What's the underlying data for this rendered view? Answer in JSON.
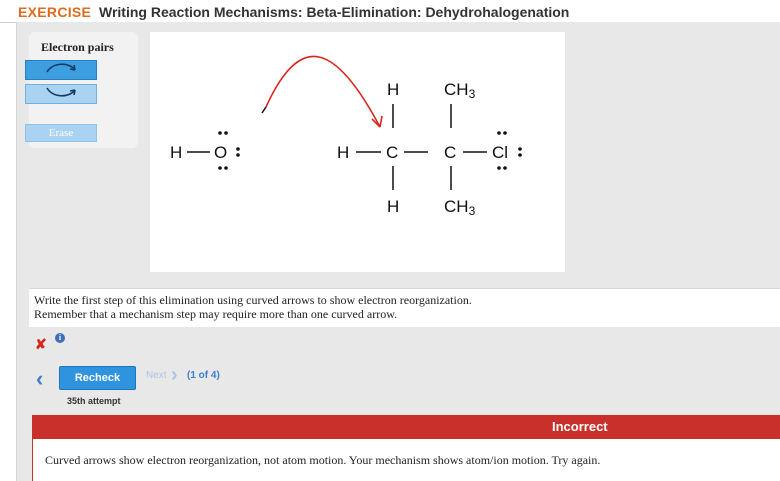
{
  "header": {
    "exercise_label": "EXERCISE",
    "title": "Writing Reaction Mechanisms: Beta-Elimination: Dehydrohalogenation"
  },
  "toolbox": {
    "title": "Electron pairs",
    "tools": [
      {
        "name": "arrow-clockwise-icon"
      },
      {
        "name": "arrow-counterclockwise-icon"
      }
    ],
    "erase_label": "Erase"
  },
  "molecule": {
    "labels": {
      "h_hydroxide": "H",
      "o_hydroxide": "O",
      "h_c1_top": "H",
      "h_c1_left": "H",
      "c1": "C",
      "h_c1_bottom": "H",
      "ch3_top": "CH",
      "ch3_top_sub": "3",
      "c2": "C",
      "cl": "Cl",
      "ch3_bottom": "CH",
      "ch3_bottom_sub": "3"
    },
    "colors": {
      "arrow": "#d9261c",
      "bond": "#111111"
    }
  },
  "instructions": {
    "line1": "Write the first step of this elimination using curved arrows to show electron reorganization.",
    "line2": "Remember that a mechanism step may require more than one curved arrow."
  },
  "status": {
    "result_icon": "x-mark-icon",
    "info_icon": "info-icon"
  },
  "navigation": {
    "recheck_label": "Recheck",
    "next_label": "Next",
    "counter": "(1 of 4)",
    "attempt": "35th attempt"
  },
  "feedback": {
    "heading": "Incorrect",
    "message": "Curved arrows show electron reorganization, not atom motion. Your mechanism shows atom/ion motion. Try again."
  },
  "colors": {
    "accent": "#2f93dd",
    "error": "#c9302c",
    "exercise": "#e06b1f"
  }
}
